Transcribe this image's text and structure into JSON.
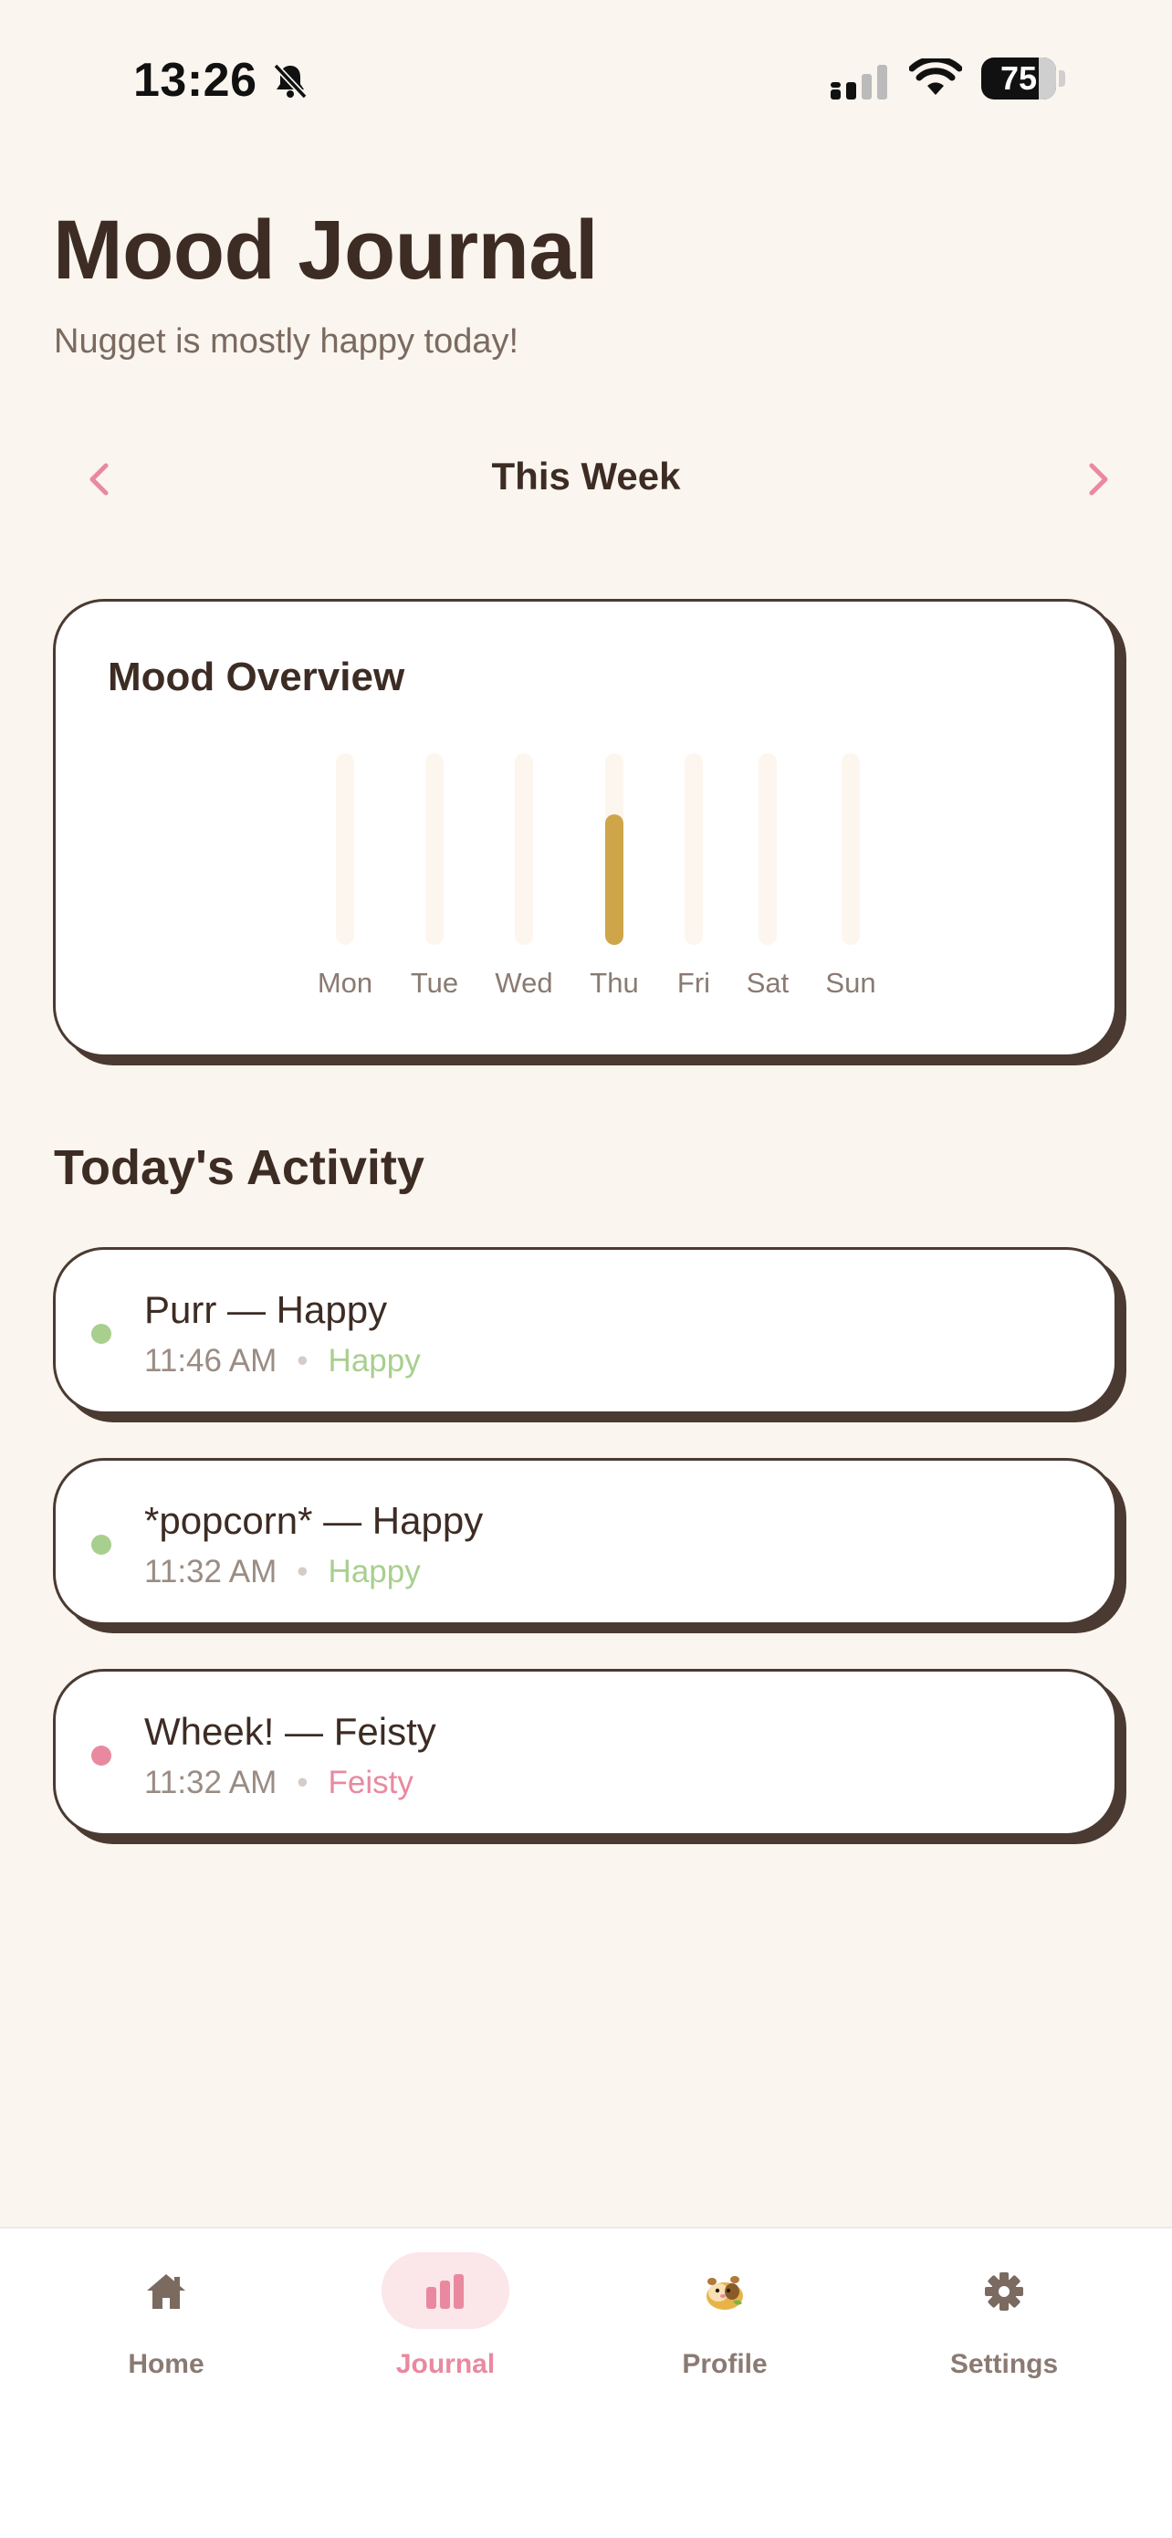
{
  "status_bar": {
    "time": "13:26",
    "battery": "75"
  },
  "header": {
    "title": "Mood Journal",
    "subtitle": "Nugget is mostly happy today!"
  },
  "week_nav": {
    "label": "This Week"
  },
  "mood_overview": {
    "title": "Mood Overview",
    "days": [
      "Mon",
      "Tue",
      "Wed",
      "Thu",
      "Fri",
      "Sat",
      "Sun"
    ]
  },
  "chart_data": {
    "type": "bar",
    "title": "Mood Overview",
    "categories": [
      "Mon",
      "Tue",
      "Wed",
      "Thu",
      "Fri",
      "Sat",
      "Sun"
    ],
    "values": [
      0,
      0,
      0,
      0.68,
      0,
      0,
      0
    ],
    "ylim": [
      0,
      1
    ],
    "grid": false,
    "colors": {
      "bar": "#cfa54a",
      "track": "#fdf6ef"
    }
  },
  "activity": {
    "title": "Today's Activity",
    "items": [
      {
        "title": "Purr — Happy",
        "time": "11:46 AM",
        "mood": "Happy",
        "color": "#a8cf8e"
      },
      {
        "title": "*popcorn* — Happy",
        "time": "11:32 AM",
        "mood": "Happy",
        "color": "#a8cf8e"
      },
      {
        "title": "Wheek! — Feisty",
        "time": "11:32 AM",
        "mood": "Feisty",
        "color": "#e9899f"
      }
    ]
  },
  "tabs": [
    {
      "label": "Home",
      "icon": "home-icon"
    },
    {
      "label": "Journal",
      "icon": "bar-chart-icon",
      "active": true
    },
    {
      "label": "Profile",
      "icon": "guinea-pig-icon"
    },
    {
      "label": "Settings",
      "icon": "gear-icon"
    }
  ],
  "colors": {
    "accent": "#e9899f",
    "background": "#faf5ee",
    "text": "#3d2c24",
    "happy": "#a8cf8e",
    "feisty": "#e9899f"
  }
}
